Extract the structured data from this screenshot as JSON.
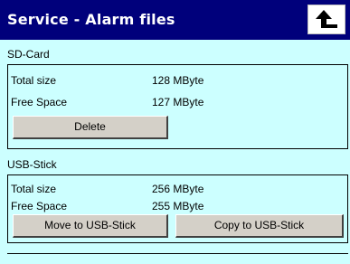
{
  "header": {
    "title": "Service - Alarm files",
    "back_icon": "arrow-up-return-icon"
  },
  "sd_card": {
    "label": "SD-Card",
    "total_size_label": "Total size",
    "total_size_value": "128 MByte",
    "free_space_label": "Free Space",
    "free_space_value": "127 MByte",
    "delete_label": "Delete"
  },
  "usb_stick": {
    "label": "USB-Stick",
    "total_size_label": "Total size",
    "total_size_value": "256 MByte",
    "free_space_label": "Free Space",
    "free_space_value": "255 MByte",
    "move_label": "Move to USB-Stick",
    "copy_label": "Copy to USB-Stick"
  },
  "colors": {
    "title_bar": "#00007b",
    "background": "#ccffff",
    "button": "#d4d0c8"
  }
}
